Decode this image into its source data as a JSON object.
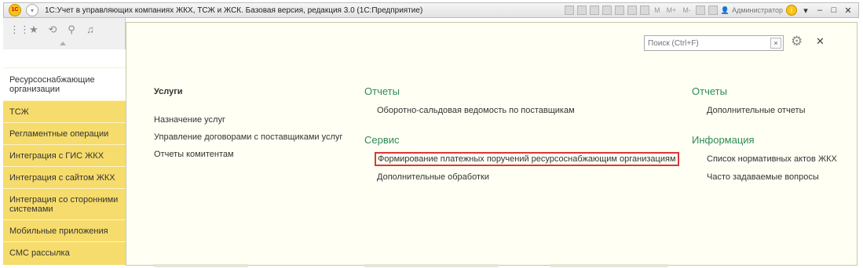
{
  "titlebar": {
    "title": "1С:Учет в управляющих компаниях ЖКХ, ТСЖ и ЖСК. Базовая версия, редакция 3.0  (1С:Предприятие)",
    "logo": "1С",
    "toolbar_labels": [
      "M",
      "M+",
      "M-"
    ],
    "user": "Администратор"
  },
  "left_tools": {
    "icons": [
      "grid-icon",
      "star-icon",
      "history-icon",
      "search-icon",
      "bell-icon"
    ]
  },
  "sidebar": {
    "items": [
      {
        "label": "Ресурсоснабжающие организации",
        "active": true
      },
      {
        "label": "ТСЖ"
      },
      {
        "label": "Регламентные операции"
      },
      {
        "label": "Интеграция с ГИС ЖКХ"
      },
      {
        "label": "Интеграция с сайтом ЖКХ"
      },
      {
        "label": "Интеграция со сторонними системами"
      },
      {
        "label": "Мобильные приложения"
      },
      {
        "label": "СМС рассылка"
      }
    ]
  },
  "search": {
    "placeholder": "Поиск (Ctrl+F)"
  },
  "col1": {
    "heading": "Услуги",
    "links": [
      "Назначение услуг",
      "Управление договорами с поставщиками услуг",
      "Отчеты комитентам"
    ]
  },
  "col2": {
    "section1_heading": "Отчеты",
    "section1_links": [
      "Оборотно-сальдовая ведомость по поставщикам"
    ],
    "section2_heading": "Сервис",
    "section2_links": [
      "Формирование платежных поручений ресурсоснабжающим организациям",
      "Дополнительные обработки"
    ]
  },
  "col3": {
    "section1_heading": "Отчеты",
    "section1_links": [
      "Дополнительные отчеты"
    ],
    "section2_heading": "Информация",
    "section2_links": [
      "Список нормативных актов ЖКХ",
      "Часто задаваемые вопросы"
    ]
  },
  "colors": {
    "sidebar_bg": "#f6dc6c",
    "panel_bg": "#fffff4",
    "heading_green": "#2e8b57",
    "highlight_red": "#d93838"
  }
}
